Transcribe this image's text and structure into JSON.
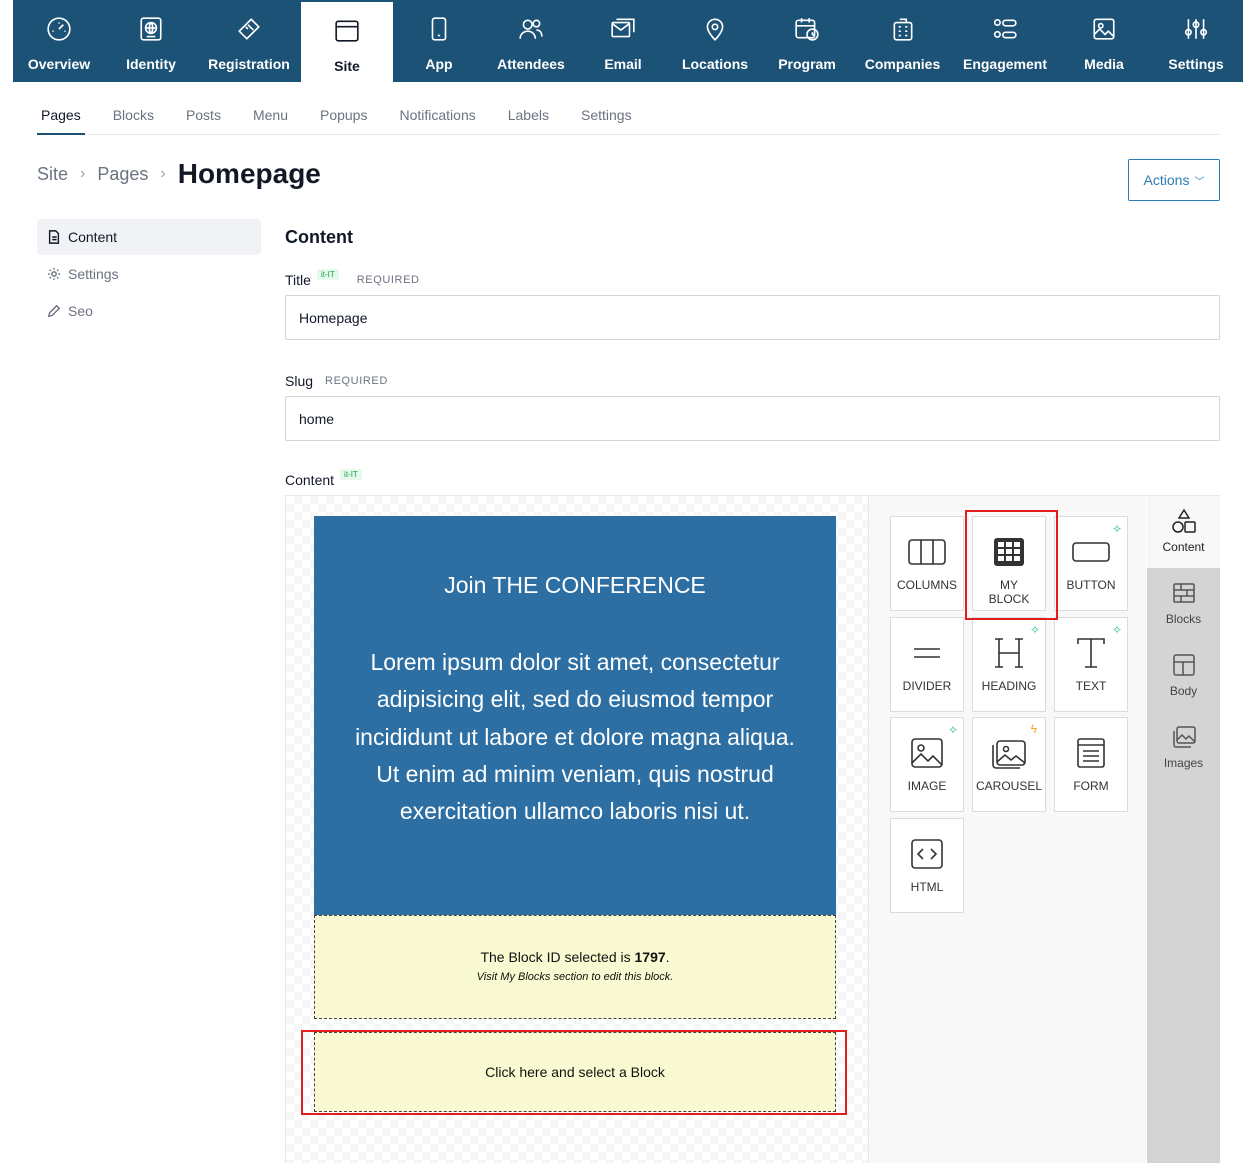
{
  "topnav": {
    "items": [
      {
        "label": "Overview",
        "icon": "gauge-icon"
      },
      {
        "label": "Identity",
        "icon": "globe-badge-icon"
      },
      {
        "label": "Registration",
        "icon": "ticket-icon"
      },
      {
        "label": "Site",
        "icon": "browser-window-icon",
        "active": true
      },
      {
        "label": "App",
        "icon": "smartphone-icon"
      },
      {
        "label": "Attendees",
        "icon": "users-icon"
      },
      {
        "label": "Email",
        "icon": "email-icon"
      },
      {
        "label": "Locations",
        "icon": "map-pin-icon"
      },
      {
        "label": "Program",
        "icon": "calendar-clock-icon"
      },
      {
        "label": "Companies",
        "icon": "building-icon"
      },
      {
        "label": "Engagement",
        "icon": "engagement-icon"
      },
      {
        "label": "Media",
        "icon": "image-icon"
      },
      {
        "label": "Settings",
        "icon": "sliders-icon"
      }
    ]
  },
  "subtabs": [
    "Pages",
    "Blocks",
    "Posts",
    "Menu",
    "Popups",
    "Notifications",
    "Labels",
    "Settings"
  ],
  "breadcrumb": {
    "root": "Site",
    "parent": "Pages",
    "current": "Homepage"
  },
  "actions": {
    "label": "Actions"
  },
  "sidemenu": [
    {
      "label": "Content",
      "icon": "document-icon"
    },
    {
      "label": "Settings",
      "icon": "gear-icon"
    },
    {
      "label": "Seo",
      "icon": "pencil-icon"
    }
  ],
  "form": {
    "section_title": "Content",
    "title_label": "Title",
    "title_locale": "it-IT",
    "title_required": "REQUIRED",
    "title_value": "Homepage",
    "slug_label": "Slug",
    "slug_required": "REQUIRED",
    "slug_value": "home",
    "content_label": "Content",
    "content_locale": "it-IT"
  },
  "canvas": {
    "hero_title": "Join THE CONFERENCE",
    "hero_body": "Lorem ipsum dolor sit amet, consectetur adipisicing elit, sed do eiusmod tempor incididunt ut labore et dolore magna aliqua. Ut enim ad minim veniam, quis nostrud exercitation ullamco laboris nisi ut.",
    "hero_color": "#2d6fa3",
    "block_selected_prefix": "The Block ID selected is ",
    "block_id": "1797",
    "block_selected_suffix": ".",
    "block_hint": "Visit My Blocks section to edit this block.",
    "placeholder": "Click here and select a Block",
    "placeholder_bg": "#fafad2"
  },
  "tools": [
    {
      "label": "COLUMNS",
      "icon": "columns-icon"
    },
    {
      "label": "MY BLOCK",
      "icon": "grid-block-icon"
    },
    {
      "label": "BUTTON",
      "icon": "button-icon",
      "badge": "sparkle"
    },
    {
      "label": "DIVIDER",
      "icon": "divider-icon"
    },
    {
      "label": "HEADING",
      "icon": "heading-icon",
      "badge": "sparkle"
    },
    {
      "label": "TEXT",
      "icon": "text-icon",
      "badge": "sparkle"
    },
    {
      "label": "IMAGE",
      "icon": "image-icon",
      "badge": "sparkle"
    },
    {
      "label": "CAROUSEL",
      "icon": "carousel-icon",
      "badge": "bolt"
    },
    {
      "label": "FORM",
      "icon": "form-icon"
    },
    {
      "label": "HTML",
      "icon": "code-icon"
    }
  ],
  "rail": [
    {
      "label": "Content",
      "icon": "shapes-icon"
    },
    {
      "label": "Blocks",
      "icon": "brick-icon"
    },
    {
      "label": "Body",
      "icon": "layout-icon"
    },
    {
      "label": "Images",
      "icon": "images-icon"
    }
  ],
  "colors": {
    "nav_bg": "#1d5277",
    "accent": "#2c7bb6",
    "highlight": "#e11d1d"
  }
}
